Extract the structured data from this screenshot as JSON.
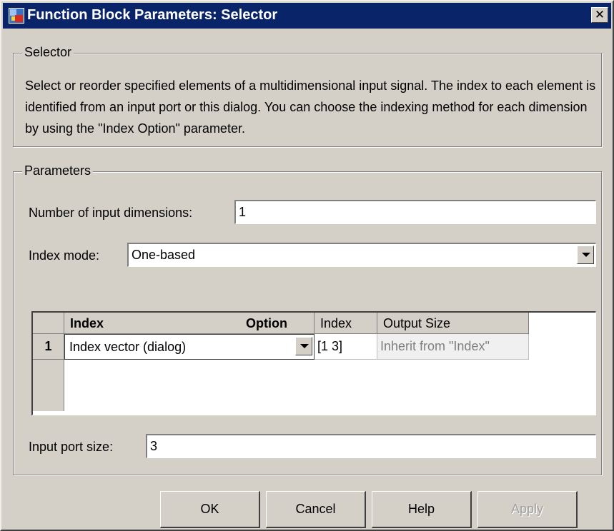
{
  "window": {
    "title": "Function Block Parameters: Selector",
    "close_glyph": "✕"
  },
  "selector_group": {
    "legend": "Selector",
    "description": "Select or reorder specified elements of a multidimensional input signal. The index to each element is identified from an input port or this dialog. You can choose the indexing method for each dimension by using the \"Index Option\" parameter."
  },
  "parameters_group": {
    "legend": "Parameters",
    "num_dims_label": "Number of input dimensions:",
    "num_dims_value": "1",
    "index_mode_label": "Index mode:",
    "index_mode_value": "One-based",
    "table": {
      "headers": [
        "Index",
        "Option",
        "Index",
        "Output Size"
      ],
      "rows": [
        {
          "row_label": "1",
          "option": "Index vector (dialog)",
          "index": "[1 3]",
          "output_size": "Inherit from \"Index\""
        }
      ]
    },
    "input_port_size_label": "Input port size:",
    "input_port_size_value": "3"
  },
  "buttons": {
    "ok": "OK",
    "cancel": "Cancel",
    "help": "Help",
    "apply": "Apply"
  },
  "icons": {
    "title_icon": "simulink-block-icon",
    "dropdown": "chevron-down-icon"
  }
}
